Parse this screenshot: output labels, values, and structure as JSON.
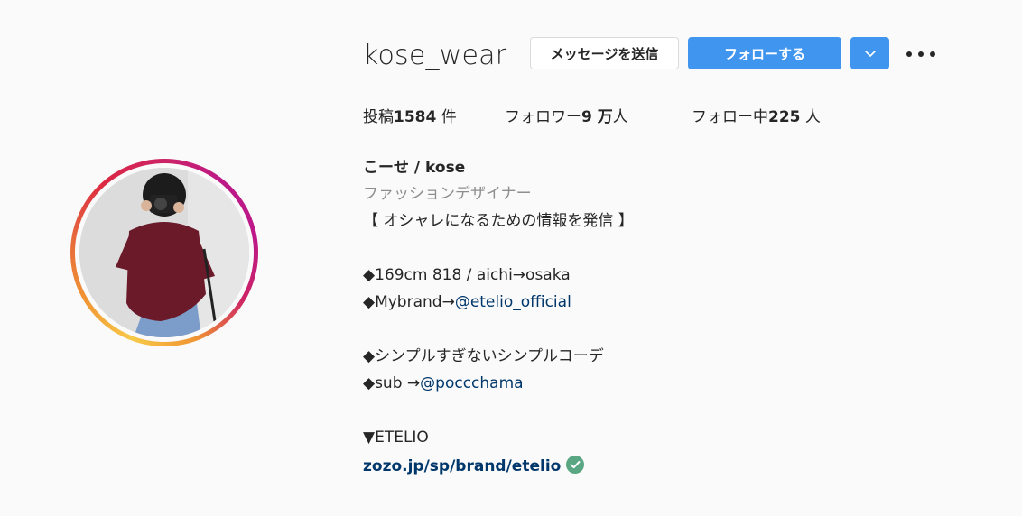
{
  "profile": {
    "username": "kose_wear",
    "message_button": "メッセージを送信",
    "follow_button": "フォローする",
    "dropdown_icon": "chevron-down-icon",
    "more_icon": "more-horizontal-icon"
  },
  "stats": {
    "posts_label": "投稿",
    "posts_value": "1584",
    "posts_unit": " 件",
    "followers_label": "フォロワー",
    "followers_value": "9 万",
    "followers_unit": "人",
    "following_label": "フォロー中",
    "following_value": "225",
    "following_unit": " 人"
  },
  "bio": {
    "full_name": "こーせ / kose",
    "category": "ファッションデザイナー",
    "line1": "【 オシャレになるための情報を発信 】",
    "line2": "◆169cm 818 / aichi→osaka",
    "line3_prefix": "◆Mybrand→",
    "line3_mention": "@etelio_official",
    "line4": "◆シンプルすぎないシンプルコーデ",
    "line5_prefix": "◆sub →",
    "line5_mention": "@poccchama",
    "line6": "▼ETELIO",
    "website": "zozo.jp/sp/brand/etelio",
    "verified_icon": "check-circle-icon"
  },
  "colors": {
    "follow_blue": "#4095ef",
    "link_color": "#00376b",
    "category_gray": "#8e8e8e",
    "verified_green": "#5aa582"
  }
}
